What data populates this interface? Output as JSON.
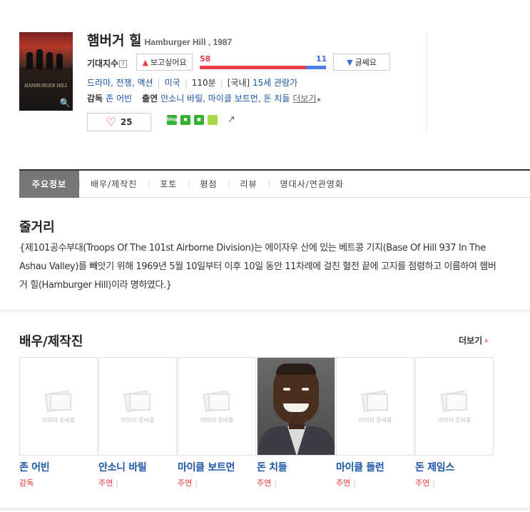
{
  "movie": {
    "title": "햄버거 힐",
    "subtitle": "Hamburger Hill , 1987",
    "poster_title": "HAMBURGER HILL"
  },
  "expectation": {
    "label": "기대지수",
    "help": "?",
    "want_label": "보고싶어요",
    "want_count": "58",
    "bad_label": "글쎄요",
    "bad_count": "11",
    "want_ratio": 0.84
  },
  "meta": {
    "genres": "드라마, 전쟁, 액션",
    "country": "미국",
    "runtime": "110분",
    "rating_region": "[국내]",
    "rating": "15세 관람가"
  },
  "credits": {
    "director_label": "감독",
    "director": "존 어빈",
    "cast_label": "출연",
    "cast": "안소니 바릴, 마이클 보트먼, 돈 치들",
    "more": "더보기"
  },
  "like": {
    "count": "25"
  },
  "share_icons": [
    "blog-icon",
    "me2day-icon",
    "bookmark-icon",
    "yozm-icon",
    "export-icon"
  ],
  "share_labels": {
    "blog": "blog"
  },
  "tabs": [
    {
      "label": "주요정보",
      "active": true
    },
    {
      "label": "배우/제작진"
    },
    {
      "label": "포토"
    },
    {
      "label": "평점"
    },
    {
      "label": "리뷰"
    },
    {
      "label": "명대사/연관영화"
    }
  ],
  "synopsis": {
    "heading": "줄거리",
    "text": "{제101공수부대(Troops Of The 101st Airborne Division)는 에이자우 산에 있는 베트콩 기지(Base Of Hill 937 In The Ashau Valley)를 빼앗기 위해 1969년 5월 10일부터 이후 10일 동안 11차례에 걸친 혈전 끝에 고지를 점령하고 이름하여 햄버거 힐(Hamburger Hill)이라 명하였다.}"
  },
  "cast_section": {
    "heading": "배우/제작진",
    "more": "더보기",
    "noimage_text": "이미지 준비중",
    "people": [
      {
        "name": "존 어빈",
        "role": "감독",
        "has_photo": false
      },
      {
        "name": "안소니 바릴",
        "role": "주연",
        "has_photo": false
      },
      {
        "name": "마이클 보트먼",
        "role": "주연",
        "has_photo": false
      },
      {
        "name": "돈 치들",
        "role": "주연",
        "has_photo": true
      },
      {
        "name": "마이클 돌런",
        "role": "주연",
        "has_photo": false
      },
      {
        "name": "돈 제임스",
        "role": "주연",
        "has_photo": false
      }
    ]
  },
  "colors": {
    "want": "#e8414b",
    "bad": "#3a6fe0",
    "link": "#1a55a5",
    "tab_active": "#777777"
  }
}
